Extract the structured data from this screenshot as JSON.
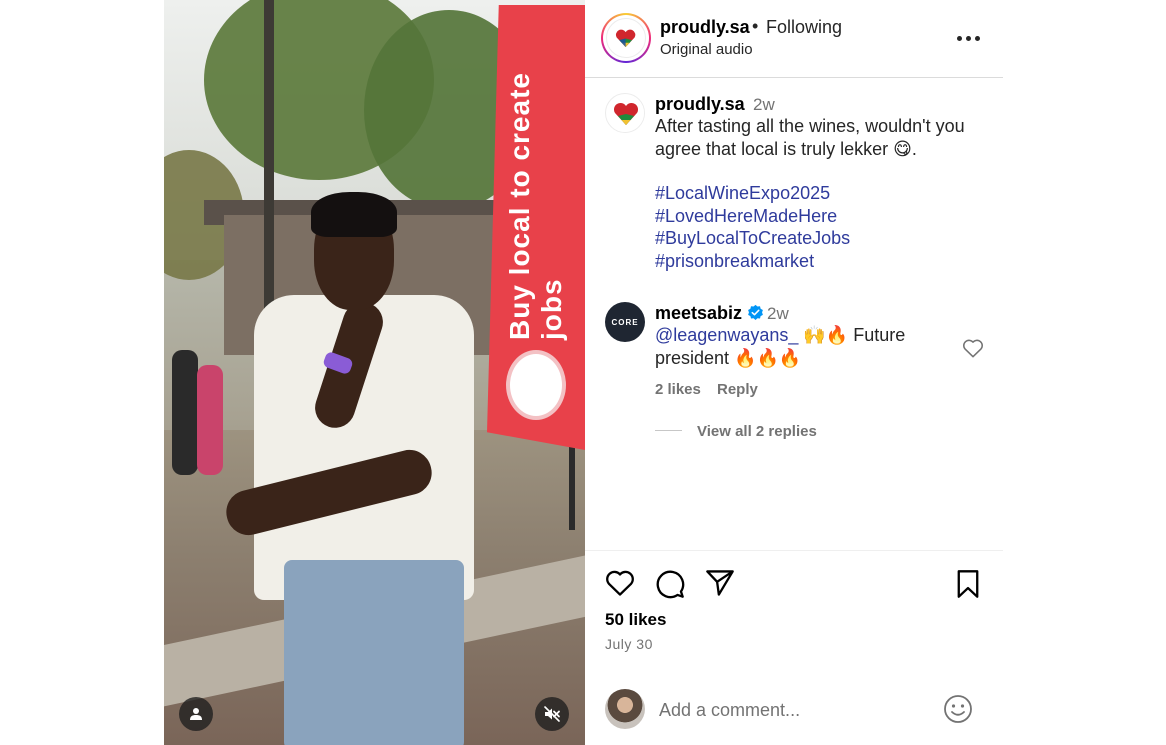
{
  "post": {
    "username": "proudly.sa",
    "separator": "•",
    "follow_status": "Following",
    "audio": "Original audio"
  },
  "caption": {
    "username": "proudly.sa",
    "time": "2w",
    "text": "After tasting all the wines, wouldn't you agree that local is truly lekker 😋.",
    "hashtags": [
      "#LocalWineExpo2025",
      "#LovedHereMadeHere",
      "#BuyLocalToCreateJobs",
      "#prisonbreakmarket"
    ]
  },
  "video": {
    "banner_text": "Buy local to create jobs"
  },
  "comment": {
    "avatar_text": "CORE",
    "username": "meetsabiz",
    "time": "2w",
    "mention": "@leagenwayans_",
    "text": " 🙌🔥 Future president 🔥🔥🔥",
    "likes": "2 likes",
    "reply_label": "Reply",
    "view_replies": "View all 2 replies"
  },
  "engagement": {
    "likes": "50 likes",
    "date": "July 30"
  },
  "composer": {
    "placeholder": "Add a comment..."
  },
  "icons": {
    "like": "heart-icon",
    "comment": "comment-bubble-icon",
    "share": "send-paper-plane-icon",
    "save": "bookmark-icon",
    "emoji": "emoji-smiley-icon",
    "more": "more-horizontal-icon",
    "verified": "verified-badge-icon",
    "mute": "muted-speaker-icon",
    "tag": "user-tag-icon"
  },
  "colors": {
    "hashtag": "#2f3b9c",
    "secondary_text": "#737373",
    "verified": "#0095f6",
    "banner": "#e8414a"
  }
}
